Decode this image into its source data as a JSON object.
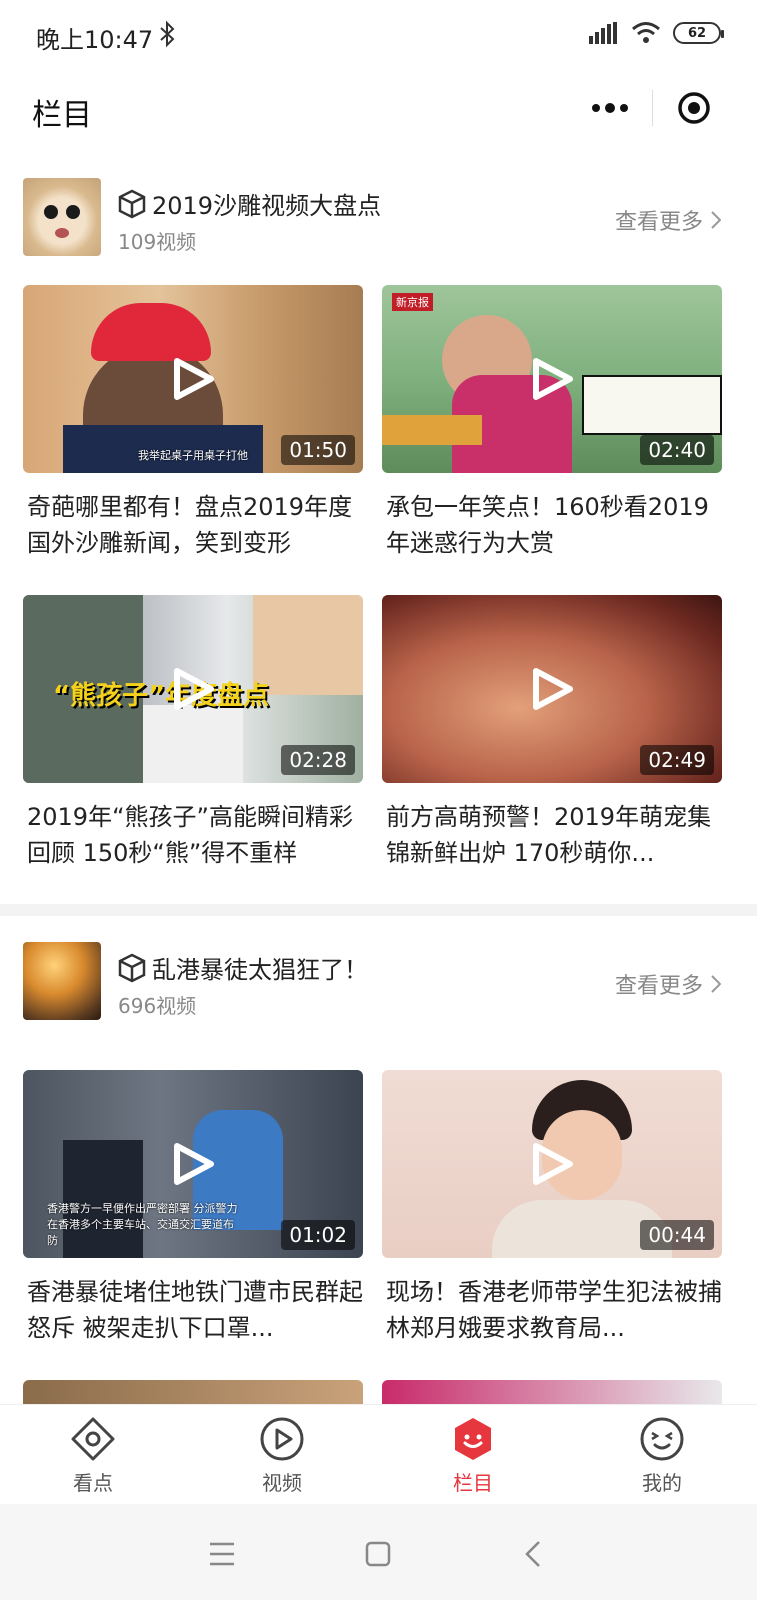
{
  "status": {
    "time": "晚上10:47",
    "battery": "62"
  },
  "header": {
    "title": "栏目"
  },
  "sections": [
    {
      "title": "2019沙雕视频大盘点",
      "count": "109视频",
      "more": "查看更多",
      "videos": [
        {
          "title": "奇葩哪里都有！盘点2019年度国外沙雕新闻，笑到变形",
          "duration": "01:50",
          "caption": "我举起桌子用桌子打他"
        },
        {
          "title": "承包一年笑点！160秒看2019年迷惑行为大赏",
          "duration": "02:40",
          "badge": "新京报"
        },
        {
          "title": "2019年“熊孩子”高能瞬间精彩回顾 150秒“熊”得不重样",
          "duration": "02:28",
          "overlay": "“熊孩子”年度盘点"
        },
        {
          "title": "前方高萌预警！2019年萌宠集锦新鲜出炉 170秒萌你...",
          "duration": "02:49"
        }
      ]
    },
    {
      "title": "乱港暴徒太猖狂了！",
      "count": "696视频",
      "more": "查看更多",
      "videos": [
        {
          "title": "香港暴徒堵住地铁门遭市民群起怒斥 被架走扒下口罩...",
          "duration": "01:02",
          "caption": "香港警方一早便作出严密部署 分派警力在香港多个主要车站、交通交汇要道布防"
        },
        {
          "title": "现场！香港老师带学生犯法被捕 林郑月娥要求教育局...",
          "duration": "00:44"
        }
      ]
    }
  ],
  "tabs": [
    {
      "label": "看点",
      "icon": "eye-icon"
    },
    {
      "label": "视频",
      "icon": "play-circle-icon"
    },
    {
      "label": "栏目",
      "icon": "columns-icon",
      "active": true
    },
    {
      "label": "我的",
      "icon": "smile-icon"
    }
  ],
  "colors": {
    "accent": "#e5373d",
    "text": "#222222",
    "muted": "#888888"
  }
}
